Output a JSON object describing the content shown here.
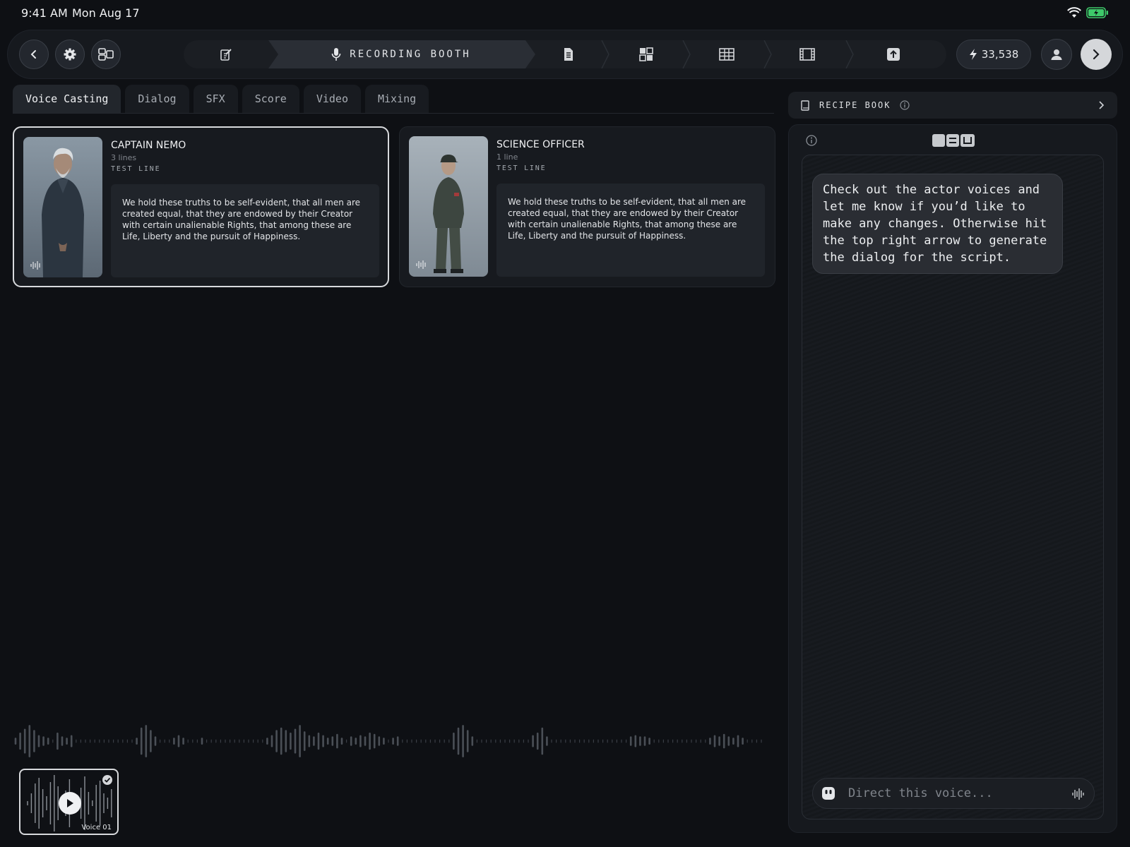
{
  "status_bar": {
    "time": "9:41 AM",
    "date": "Mon Aug 17"
  },
  "toolbar": {
    "active_step_label": "RECORDING BOOTH",
    "credits": "33,538",
    "pipeline_icons": [
      "script-edit-icon",
      "microphone-icon",
      "document-icon",
      "storyboard-icon",
      "table-icon",
      "film-icon",
      "export-icon"
    ]
  },
  "tabs": [
    "Voice Casting",
    "Dialog",
    "SFX",
    "Score",
    "Video",
    "Mixing"
  ],
  "cards": [
    {
      "name": "CAPTAIN NEMO",
      "lines": "3 lines",
      "test_label": "TEST LINE",
      "quote": "We hold these truths to be self-evident, that all men are created equal, that they are endowed by their Creator with certain unalienable Rights, that among these are Life, Liberty and the pursuit of Happiness."
    },
    {
      "name": "SCIENCE OFFICER",
      "lines": "1 line",
      "test_label": "TEST LINE",
      "quote": "We hold these truths to be self-evident, that all men are created equal, that they are endowed by their Creator with certain unalienable Rights, that among these are Life, Liberty and the pursuit of Happiness."
    }
  ],
  "voice_thumb": {
    "label": "Voice 01"
  },
  "recipe_book": {
    "label": "RECIPE BOOK"
  },
  "chat": {
    "message": "Check out the actor voices and let me know if you’d like to make any changes. Otherwise hit the top right arrow to generate the dialog for the script.",
    "placeholder": "Direct this voice..."
  },
  "colors": {
    "background": "#0e1014",
    "panel": "#16191e",
    "accent": "#d8dadd",
    "battery": "#3ec96a"
  }
}
